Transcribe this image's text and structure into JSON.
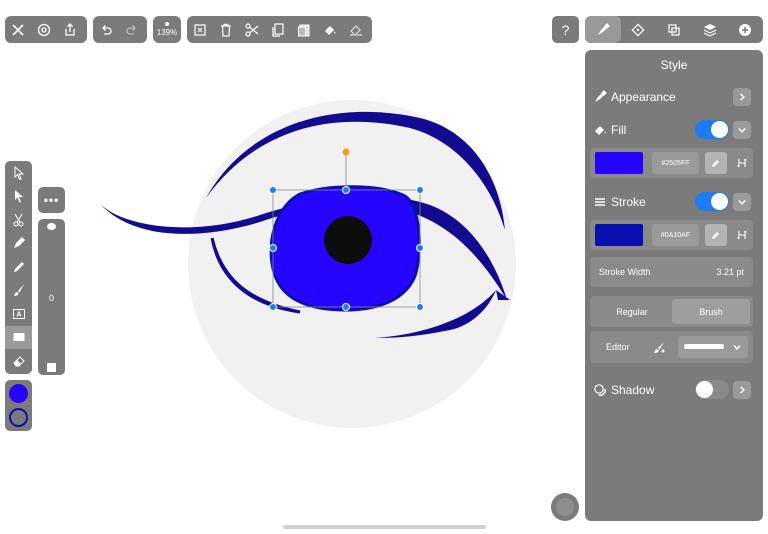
{
  "toolbar": {
    "zoom_label": "139%",
    "file_icons": [
      "close-icon",
      "settings-icon",
      "share-icon"
    ],
    "history_icons": [
      "undo-icon",
      "redo-icon"
    ],
    "edit_icons": [
      "deselect-icon",
      "trash-icon",
      "scissors-icon",
      "copy-icon",
      "paste-icon",
      "fill-tool-icon",
      "clear-fill-icon"
    ]
  },
  "left_tools": [
    "select-arrow-icon",
    "direct-select-icon",
    "scissors-icon",
    "pen-icon",
    "pencil-icon",
    "brush-icon",
    "text-tool-icon",
    "shape-tool-icon",
    "eraser-icon"
  ],
  "size_slider": {
    "value": "0"
  },
  "colors": {
    "fill": "#2505FF",
    "stroke": "#0A10AF"
  },
  "help_label": "?",
  "panel_tabs": [
    "style-tab-icon",
    "points-tab-icon",
    "arrange-tab-icon",
    "layers-tab-icon",
    "add-tab-icon"
  ],
  "style_panel": {
    "title": "Style",
    "appearance_label": "Appearance",
    "fill_label": "Fill",
    "fill_hex": "#2505FF",
    "fill_on": true,
    "stroke_label": "Stroke",
    "stroke_hex": "#0A10AF",
    "stroke_on": true,
    "stroke_width_label": "Stroke Width",
    "stroke_width_value": "3.21 pt",
    "regular_label": "Regular",
    "brush_label": "Brush",
    "editor_label": "Editor",
    "shadow_label": "Shadow",
    "shadow_on": false
  }
}
